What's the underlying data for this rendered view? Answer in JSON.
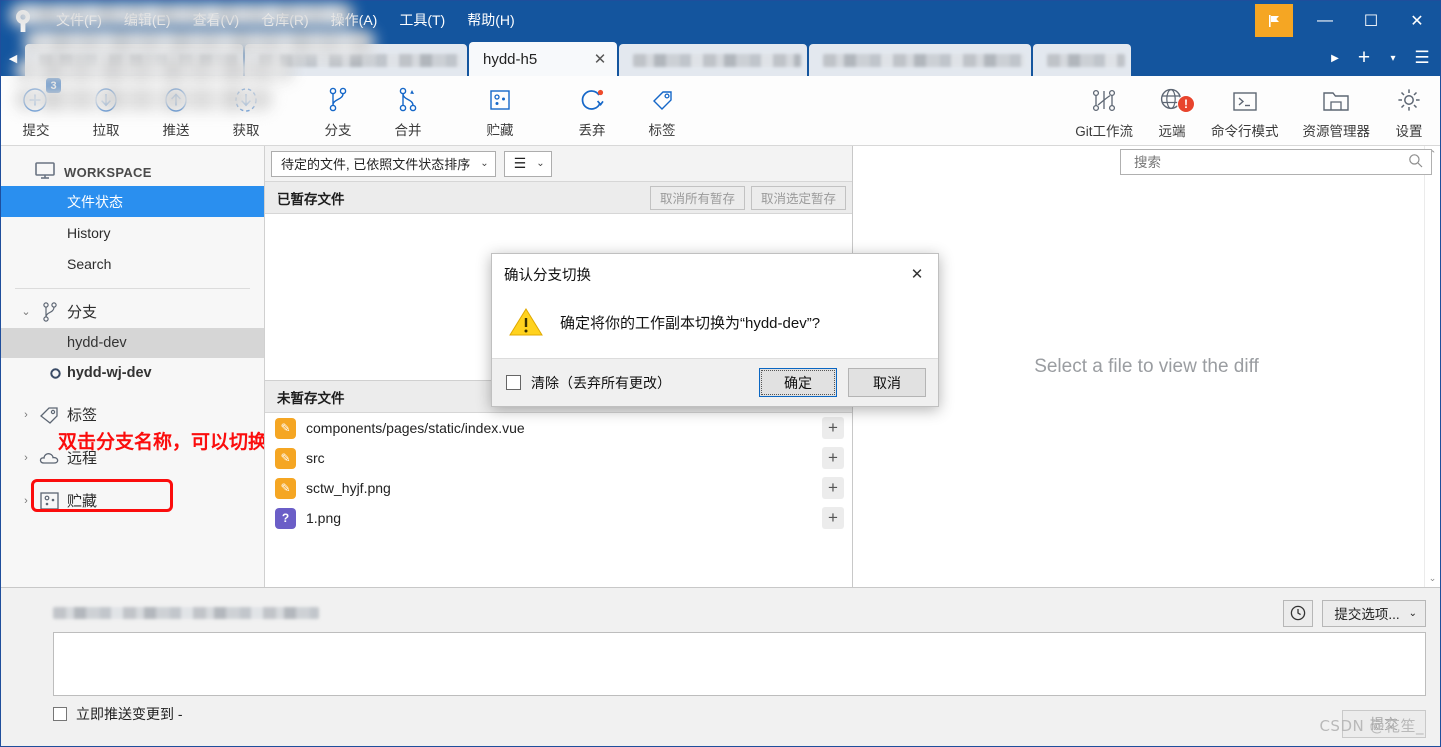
{
  "window": {
    "app_logo": "sourcetree-logo-icon",
    "menus": [
      {
        "label": "文件(F)"
      },
      {
        "label": "编辑(E)"
      },
      {
        "label": "查看(V)"
      },
      {
        "label": "仓库(R)"
      },
      {
        "label": "操作(A)"
      },
      {
        "label": "工具(T)"
      },
      {
        "label": "帮助(H)"
      }
    ],
    "flag_button": "▶",
    "minimize": "—",
    "maximize": "☐",
    "close": "✕",
    "titlebar_color": "#14559e",
    "accent_color": "#f5a623"
  },
  "tabs": {
    "items": [
      {
        "label": "",
        "blurred": true,
        "active": false
      },
      {
        "label": "",
        "blurred": true,
        "active": false
      },
      {
        "label": "hydd-h5",
        "blurred": false,
        "active": true,
        "close": "✕"
      },
      {
        "label": "",
        "blurred": true,
        "active": false
      },
      {
        "label": "",
        "blurred": true,
        "active": false
      },
      {
        "label": "",
        "blurred": true,
        "active": false
      }
    ],
    "scroll_left": "◀",
    "scroll_right": "▶",
    "new_tab": "+",
    "tab_dropdown": "▾",
    "menu_button": "☰"
  },
  "toolbar": {
    "items": [
      {
        "label": "提交",
        "icon": "commit-plus-icon",
        "badge": "3"
      },
      {
        "label": "拉取",
        "icon": "pull-down-arrow-icon"
      },
      {
        "label": "推送",
        "icon": "push-up-arrow-icon"
      },
      {
        "label": "获取",
        "icon": "fetch-dashed-arrow-icon"
      },
      {
        "label": "分支",
        "icon": "branch-icon"
      },
      {
        "label": "合并",
        "icon": "merge-icon"
      },
      {
        "label": "贮藏",
        "icon": "stash-box-icon"
      },
      {
        "label": "丢弃",
        "icon": "discard-refresh-icon",
        "badge_alert": "!"
      },
      {
        "label": "标签",
        "icon": "tag-icon"
      }
    ],
    "right_items": [
      {
        "label": "Git工作流",
        "icon": "git-flow-icon"
      },
      {
        "label": "远端",
        "icon": "remote-globe-icon",
        "badge_alert": "!"
      },
      {
        "label": "命令行模式",
        "icon": "terminal-icon"
      },
      {
        "label": "资源管理器",
        "icon": "explorer-folder-icon"
      },
      {
        "label": "设置",
        "icon": "gear-icon"
      }
    ]
  },
  "sidebar": {
    "workspace_label": "WORKSPACE",
    "workspace_icon": "monitor-icon",
    "rows": [
      {
        "label": "文件状态",
        "selected": true
      },
      {
        "label": "History",
        "selected": false
      },
      {
        "label": "Search",
        "selected": false
      }
    ],
    "groups": [
      {
        "label": "分支",
        "icon": "branch-icon",
        "expanded": true,
        "chevron": "⌄"
      },
      {
        "label": "标签",
        "icon": "tag-icon",
        "expanded": false,
        "chevron": "›"
      },
      {
        "label": "远程",
        "icon": "cloud-icon",
        "expanded": false,
        "chevron": "›"
      },
      {
        "label": "贮藏",
        "icon": "stash-box-icon",
        "expanded": false,
        "chevron": "›"
      }
    ],
    "branches": [
      {
        "label": "hydd-dev",
        "current": false,
        "highlighted": true
      },
      {
        "label": "hydd-wj-dev",
        "current": true,
        "highlighted": false
      }
    ],
    "annotation": "双击分支名称，可以切换工作副本",
    "annotation_color": "#fb0d0d"
  },
  "file_panel": {
    "filter_value": "待定的文件, 已依照文件状态排序",
    "filter_arrow": "⌄",
    "view_mode_icon": "list-view-icon",
    "view_mode_arrow": "⌄",
    "staged": {
      "title": "已暂存文件",
      "unstage_all": "取消所有暂存",
      "unstage_selected": "取消选定暂存",
      "files": []
    },
    "unstaged": {
      "title": "未暂存文件",
      "files": [
        {
          "name": "components/pages/static/index.vue",
          "status": "modified",
          "status_icon": "✎",
          "stage_button": "+",
          "blurred": true
        },
        {
          "name": "src",
          "status": "modified",
          "status_icon": "✎",
          "stage_button": "+",
          "blurred": true
        },
        {
          "name": "sctw_hyjf.png",
          "status": "modified",
          "status_icon": "✎",
          "stage_button": "+",
          "blurred": true
        },
        {
          "name": "1.png",
          "status": "untracked",
          "status_icon": "?",
          "stage_button": "+",
          "blurred": true
        }
      ]
    }
  },
  "search": {
    "placeholder": "搜索",
    "icon": "search-icon"
  },
  "diff": {
    "empty_message": "Select a file to view the diff",
    "scroll_up": "⌃",
    "scroll_down": "⌄"
  },
  "commit": {
    "clock_icon": "clock-icon",
    "commit_options_label": "提交选项...",
    "commit_options_arrow": "⌄",
    "message_value": "",
    "push_checkbox_label": "立即推送变更到 -",
    "push_checked": false,
    "commit_button": "提交"
  },
  "dialog": {
    "title": "确认分支切换",
    "close": "✕",
    "warning_icon": "warning-triangle-icon",
    "message": "确定将你的工作副本切换为“hydd-dev”?",
    "checkbox_label": "清除（丢弃所有更改）",
    "checkbox_checked": false,
    "ok_button": "确定",
    "cancel_button": "取消"
  },
  "watermark": "CSDN @花笙_"
}
